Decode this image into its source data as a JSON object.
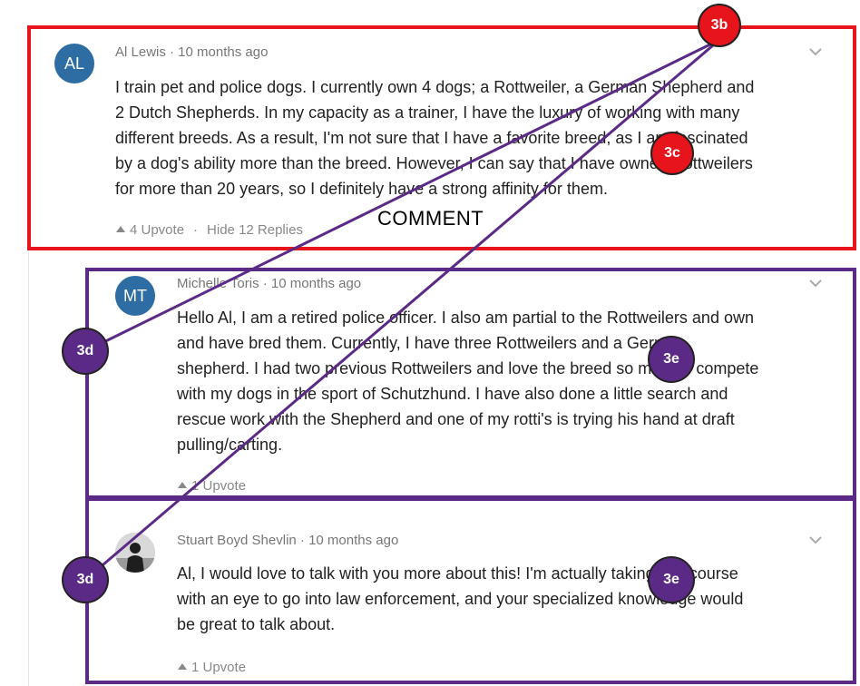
{
  "comments": [
    {
      "avatar_initials": "AL",
      "meta": "Al Lewis · 10 months ago",
      "body": "I train pet and police dogs. I currently own 4 dogs; a Rottweiler, a German Shepherd and\n2 Dutch Shepherds. In my capacity as a trainer, I have the luxury of working with many\ndifferent breeds. As a result, I'm not sure that I have a favorite breed, as I am fascinated\nby a dog's ability more than the breed. However, I can say that I have owned Rottweilers\nfor more than 20 years, so I definitely have a strong affinity for them.",
      "upvote": "4 Upvote",
      "hide_replies": "Hide 12 Replies"
    },
    {
      "avatar_initials": "MT",
      "meta": "Michelle Toris · 10 months ago",
      "body": "Hello Al, I am a retired police officer. I also am partial to the Rottweilers and own\nand have bred them. Currently, I have three Rottweilers and a German\nshepherd. I had two previous Rottweilers and love the breed so much. I compete\nwith my dogs in the sport of Schutzhund. I have also done a little search and\nrescue work with the Shepherd and one of my rotti's is trying his hand at draft\npulling/carting.",
      "upvote": "1 Upvote"
    },
    {
      "meta": "Stuart Boyd Shevlin · 10 months ago",
      "body": "Al, I would love to talk with you more about this! I'm actually taking this course\nwith an eye to go into law enforcement, and your specialized knowledge would\nbe great to talk about.",
      "upvote": "1 Upvote"
    }
  ],
  "annotations": {
    "label": "COMMENT",
    "badge_3b": "3b",
    "badge_3c": "3c",
    "badge_3d_1": "3d",
    "badge_3d_2": "3d",
    "badge_3e_1": "3e",
    "badge_3e_2": "3e"
  },
  "colors": {
    "comment_box": "#e8141c",
    "reply_box": "#5b2a86",
    "avatar": "#2e6da4"
  }
}
